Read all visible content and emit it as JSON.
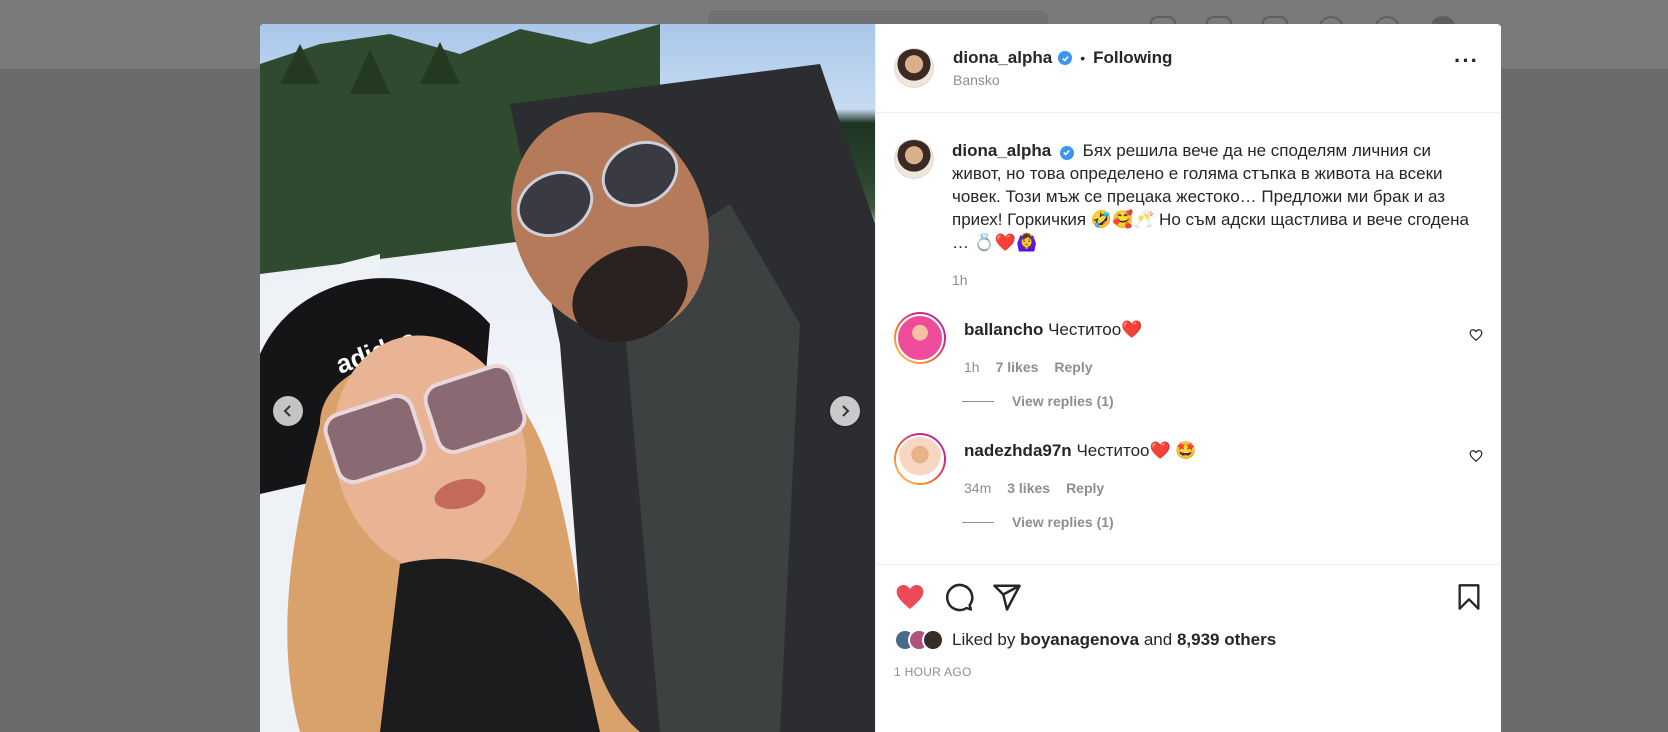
{
  "post": {
    "username": "diona_alpha",
    "follow_status": "Following",
    "location": "Bansko",
    "more_icon": "more-horizontal-icon",
    "media_alt": "Couple selfie in the snow wearing sunglasses"
  },
  "caption": {
    "username": "diona_alpha",
    "text": "Бях решила вече да не споделям личния си живот, но това определено е голяма стъпка в живота на всеки човек. Този мъж се прецака жестоко… Предложи ми брак и аз приех! Горкичкия 🤣🥰🥂  Но съм адски щастлива и вече сгодена … 💍❤️🙆‍♀️",
    "time": "1h"
  },
  "comments": [
    {
      "username": "ballancho",
      "text": "Честитоо❤️",
      "time": "1h",
      "likes": "7 likes",
      "reply": "Reply",
      "view_replies": "View replies (1)"
    },
    {
      "username": "nadezhda97n",
      "text": "Честитоо❤️ 🤩",
      "time": "34m",
      "likes": "3 likes",
      "reply": "Reply",
      "view_replies": "View replies (1)"
    }
  ],
  "likes": {
    "prefix": "Liked by",
    "user": "boyanagenova",
    "and": "and",
    "others": "8,939 others"
  },
  "timestamp": "1 HOUR AGO",
  "colors": {
    "like_red": "#ed4956",
    "verified_blue": "#3897f0",
    "muted": "#8e8e8e"
  }
}
